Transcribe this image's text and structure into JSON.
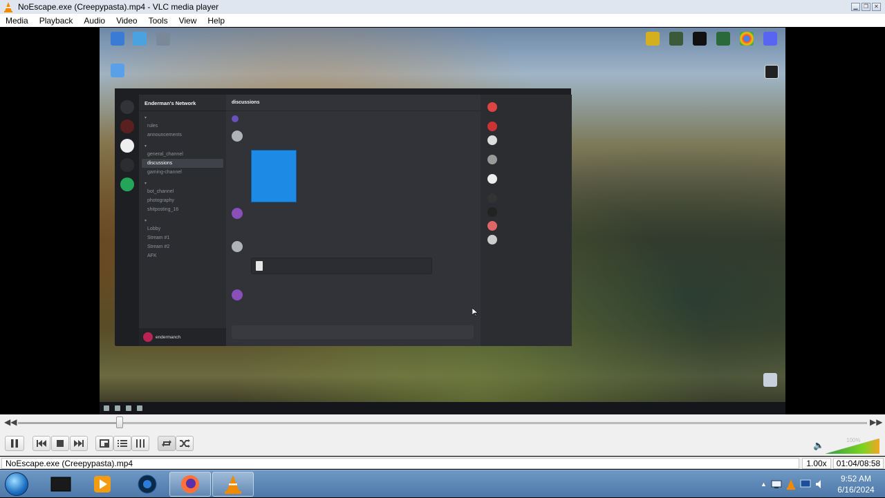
{
  "window": {
    "title": "NoEscape.exe (Creepypasta).mp4 - VLC media player",
    "min_label": "▁",
    "max_label": "❐",
    "close_label": "✕"
  },
  "menu": [
    "Media",
    "Playback",
    "Audio",
    "Video",
    "Tools",
    "View",
    "Help"
  ],
  "video": {
    "discord": {
      "server_name": "Enderman's Network",
      "active_channel": "discussions",
      "channels": [
        "rules",
        "announcements",
        "general_channel",
        "discussions",
        "gaming-channel",
        "bot_channel",
        "photography",
        "shitposting_16",
        "Lobby",
        "Stream #1",
        "Stream #2",
        "AFK"
      ],
      "user_name": "endermanch"
    }
  },
  "controls": {
    "seek_position_fraction": 0.12,
    "volume_label": "100%"
  },
  "status": {
    "filename": "NoEscape.exe (Creepypasta).mp4",
    "speed": "1.00x",
    "time": "01:04/08:58"
  },
  "taskbar": {
    "clock_time": "9:52 AM",
    "clock_date": "6/16/2024"
  }
}
